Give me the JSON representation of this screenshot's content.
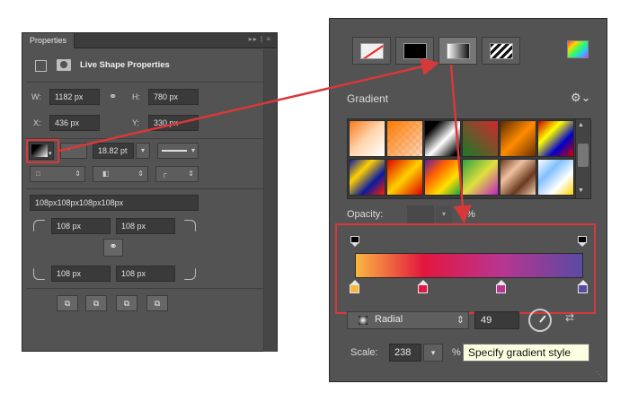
{
  "properties_panel": {
    "tab_title": "Properties",
    "header_icons": "▸▸ | ≡",
    "section_title": "Live Shape Properties",
    "w_label": "W:",
    "w_value": "1182 px",
    "h_label": "H:",
    "h_value": "780 px",
    "x_label": "X:",
    "x_value": "436 px",
    "y_label": "Y:",
    "y_value": "330 px",
    "stroke_width": "18.82 pt",
    "corner_radius_all": "108px108px108px108px",
    "corner_tl": "108 px",
    "corner_tr": "108 px",
    "corner_bl": "108 px",
    "corner_br": "108 px"
  },
  "gradient_panel": {
    "fill_types": [
      "no-fill",
      "solid-color",
      "gradient",
      "pattern"
    ],
    "section_label": "Gradient",
    "opacity_label": "Opacity:",
    "opacity_unit": "%",
    "style_value": "Radial",
    "angle_value": "49",
    "scale_label": "Scale:",
    "scale_value": "238",
    "scale_unit": "%",
    "tooltip": "Specify gradient style",
    "gradient_colors": [
      "#f9b740",
      "#e4163f",
      "#b93590",
      "#5a4aa3"
    ],
    "color_stop_positions": [
      0,
      0.3,
      0.64,
      1
    ]
  },
  "annotation": {
    "highlight_color": "#d9383a"
  }
}
